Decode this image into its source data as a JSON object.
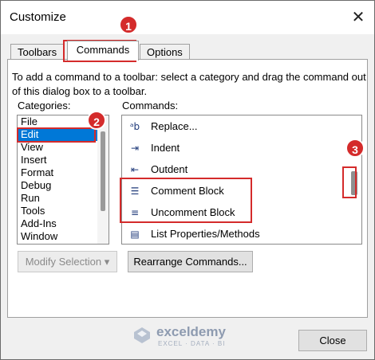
{
  "window": {
    "title": "Customize"
  },
  "tabs": [
    {
      "label": "Toolbars"
    },
    {
      "label": "Commands"
    },
    {
      "label": "Options"
    }
  ],
  "instruction": "To add a command to a toolbar: select a category and drag the command out of this dialog box to a toolbar.",
  "categories": {
    "label": "Categories:",
    "items": [
      "File",
      "Edit",
      "View",
      "Insert",
      "Format",
      "Debug",
      "Run",
      "Tools",
      "Add-Ins",
      "Window"
    ],
    "selected": "Edit"
  },
  "commands": {
    "label": "Commands:",
    "items": [
      {
        "label": "Replace...",
        "icon": "replace-icon",
        "glyph": "ᵃb"
      },
      {
        "label": "Indent",
        "icon": "indent-icon",
        "glyph": "⇥"
      },
      {
        "label": "Outdent",
        "icon": "outdent-icon",
        "glyph": "⇤"
      },
      {
        "label": "Comment Block",
        "icon": "comment-block-icon",
        "glyph": "☰"
      },
      {
        "label": "Uncomment Block",
        "icon": "uncomment-block-icon",
        "glyph": "≡"
      },
      {
        "label": "List Properties/Methods",
        "icon": "list-properties-icon",
        "glyph": "▤"
      }
    ]
  },
  "buttons": {
    "modify_selection": "Modify Selection",
    "rearrange": "Rearrange Commands...",
    "close": "Close"
  },
  "annotations": {
    "badge1": "1",
    "badge2": "2",
    "badge3": "3"
  },
  "watermark": {
    "name": "exceldemy",
    "tagline": "EXCEL · DATA · BI"
  },
  "colors": {
    "highlight": "#d42b2b",
    "selection": "#0078d7"
  }
}
